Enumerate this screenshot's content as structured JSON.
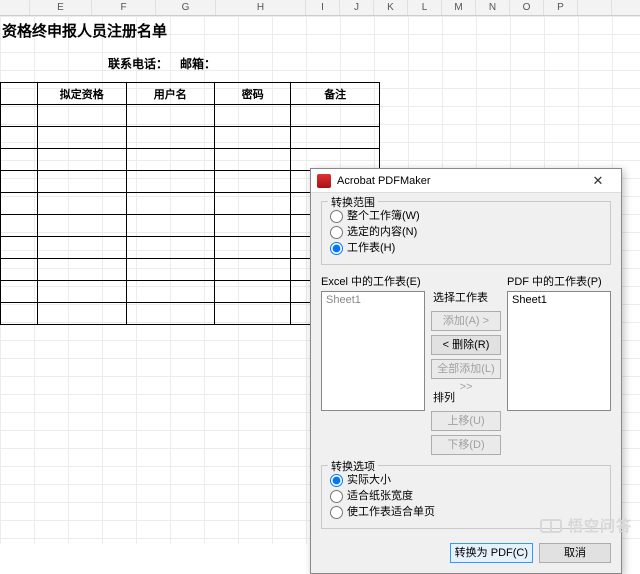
{
  "columns": [
    {
      "label": "",
      "w": 30
    },
    {
      "label": "E",
      "w": 62
    },
    {
      "label": "F",
      "w": 64
    },
    {
      "label": "G",
      "w": 60
    },
    {
      "label": "H",
      "w": 90
    },
    {
      "label": "I",
      "w": 34
    },
    {
      "label": "J",
      "w": 34
    },
    {
      "label": "K",
      "w": 34
    },
    {
      "label": "L",
      "w": 34
    },
    {
      "label": "M",
      "w": 34
    },
    {
      "label": "N",
      "w": 34
    },
    {
      "label": "O",
      "w": 34
    },
    {
      "label": "P",
      "w": 34
    },
    {
      "label": "",
      "w": 34
    }
  ],
  "doc": {
    "title": "终申报人员注册名单",
    "title_prefix": "资格",
    "phone_label": "联系电话：",
    "email_label": "邮箱：",
    "headers": [
      "",
      "拟定资格",
      "用户名",
      "密码",
      "备注"
    ],
    "row_count": 10
  },
  "dialog": {
    "title": "Acrobat PDFMaker",
    "scope": {
      "legend": "转换范围",
      "opt_workbook": "整个工作簿(W)",
      "opt_selection": "选定的内容(N)",
      "opt_sheet": "工作表(H)"
    },
    "left_list_label": "Excel 中的工作表(E)",
    "right_list_label": "PDF 中的工作表(P)",
    "left_items": [
      "Sheet1"
    ],
    "right_items": [
      "Sheet1"
    ],
    "mid": {
      "select_label": "选择工作表",
      "add": "添加(A) >",
      "remove": "< 删除(R)",
      "add_all": "全部添加(L) >>",
      "arrange_label": "排列",
      "up": "上移(U)",
      "down": "下移(D)"
    },
    "options": {
      "legend": "转换选项",
      "actual": "实际大小",
      "fit_width": "适合纸张宽度",
      "fit_page": "使工作表适合单页"
    },
    "convert": "转换为 PDF(C)",
    "cancel": "取消"
  },
  "watermark": "悟空问答"
}
